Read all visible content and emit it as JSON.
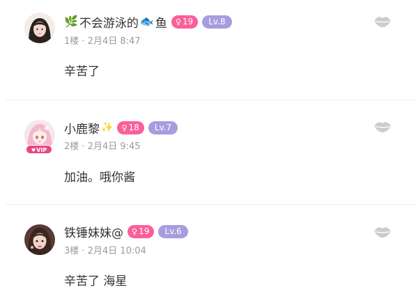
{
  "comments": [
    {
      "username": "不会游泳的",
      "username_suffix": "鱼",
      "prefix_emoji": "🌿",
      "inline_emoji": "🐟",
      "fan_level": "19",
      "user_level": "Lv.8",
      "meta": "1楼 · 2月4日  8:47",
      "text": "辛苦了",
      "avatar": "avatar-girl-dark-hair",
      "like_icon": "lips-icon"
    },
    {
      "username": "小鹿黎",
      "username_suffix": "",
      "suffix_emoji": "✨",
      "fan_level": "18",
      "user_level": "Lv.7",
      "vip_label": "VIP",
      "meta": "2楼 · 2月4日  9:45",
      "text": "加油。哦你酱",
      "avatar": "avatar-anime-pink-hair",
      "like_icon": "lips-icon"
    },
    {
      "username": "铁锤妹妹@",
      "username_suffix": "",
      "fan_level": "19",
      "user_level": "Lv.6",
      "meta": "3楼 · 2月4日  10:04",
      "text": "辛苦了 海星",
      "avatar": "avatar-girl-photo",
      "like_icon": "lips-icon"
    }
  ],
  "colors": {
    "fan_badge": "#fb5f9a",
    "level_badge": "#a89ce0",
    "vip_badge": "#e24a86",
    "meta_text": "#9a9a9a",
    "main_text": "#333333"
  }
}
